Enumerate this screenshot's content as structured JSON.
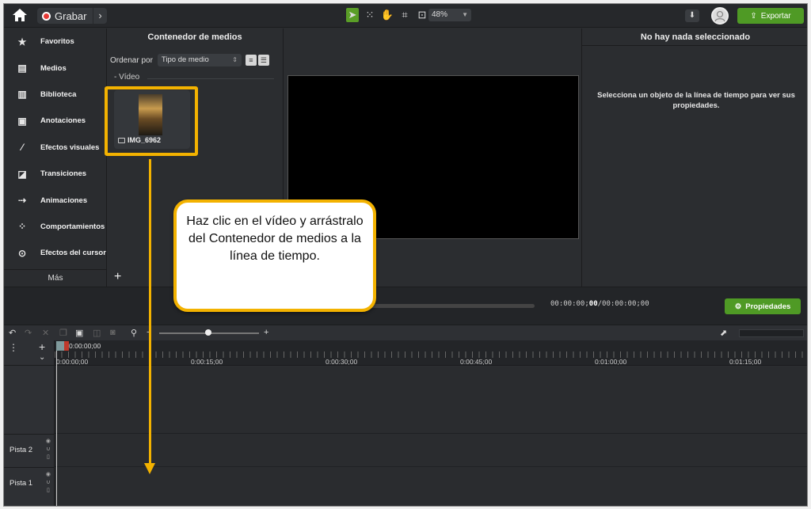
{
  "toolbar": {
    "record_label": "Grabar",
    "zoom_value": "48%",
    "export_label": "Exportar"
  },
  "sidebar": {
    "items": [
      {
        "label": "Favoritos",
        "icon": "star-icon"
      },
      {
        "label": "Medios",
        "icon": "film-icon"
      },
      {
        "label": "Biblioteca",
        "icon": "library-icon"
      },
      {
        "label": "Anotaciones",
        "icon": "annotation-icon"
      },
      {
        "label": "Efectos visuales",
        "icon": "wand-icon"
      },
      {
        "label": "Transiciones",
        "icon": "transition-icon"
      },
      {
        "label": "Animaciones",
        "icon": "animation-icon"
      },
      {
        "label": "Comportamientos",
        "icon": "behavior-icon"
      },
      {
        "label": "Efectos del cursor",
        "icon": "cursor-effect-icon"
      }
    ],
    "more_label": "Más"
  },
  "media_bin": {
    "title": "Contenedor de medios",
    "sort_label": "Ordenar por",
    "sort_value": "Tipo de medio",
    "group_label": "- Vídeo",
    "item_name": "IMG_6962"
  },
  "properties": {
    "title": "No hay nada seleccionado",
    "message": "Selecciona un objeto de la línea de tiempo para ver sus propiedades.",
    "button_label": "Propiedades"
  },
  "playback": {
    "time_current": "00:00:00;",
    "time_bold": "00",
    "time_total": "/00:00:00;00"
  },
  "timeline": {
    "playhead_time": "0:00:00;00",
    "ruler_labels": [
      "0:00:00;00",
      "0:00:15;00",
      "0:00:30;00",
      "0:00:45;00",
      "0:01:00;00",
      "0:01:15;00"
    ],
    "tracks": [
      "Pista 2",
      "Pista 1"
    ]
  },
  "callout": {
    "text": "Haz clic en el vídeo y arrástralo del Contenedor de medios a la línea de tiempo."
  },
  "colors": {
    "accent_green": "#4f9a25",
    "callout_border": "#f3b200"
  }
}
